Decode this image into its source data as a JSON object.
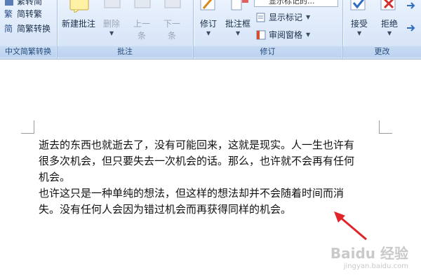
{
  "ribbon": {
    "chinese_convert": {
      "item_top": "繁转简",
      "simp_to_trad": "简转繁",
      "convert": "简繁转换",
      "group_label": "中文简繁转换"
    },
    "comments": {
      "new_comment": "新建批注",
      "delete": "删除",
      "prev_line1": "上一",
      "prev_line2": "条",
      "next_line1": "下一",
      "next_line2": "条",
      "group_label": "批注"
    },
    "tracking": {
      "track_changes": "修订",
      "balloons": "批注框",
      "display_for_review": "显示标记的...",
      "show_markup": "显示标记",
      "reviewing_pane": "审阅窗格",
      "group_label": "修订"
    },
    "changes": {
      "accept": "接受",
      "reject": "拒绝",
      "group_label": "更改"
    }
  },
  "document": {
    "paragraph1_line1": "逝去的东西也就逝去了，没有可能回来，这就是现实。人一生也许有",
    "paragraph1_line2": "很多次机会，但只要失去一次机会的话。那么，也许就不会再有任何",
    "paragraph1_line3": "机会。",
    "paragraph2_line1": "也许这只是一种单纯的想法，但这样的想法却并不会随着时间而消",
    "paragraph2_line2": "失。没有任何人会因为错过机会而再获得同样的机会。"
  },
  "watermark": {
    "brand": "Baidu 经验",
    "url": "jingyan.baidu.com"
  },
  "colors": {
    "annotation_arrow": "#e0242a"
  }
}
